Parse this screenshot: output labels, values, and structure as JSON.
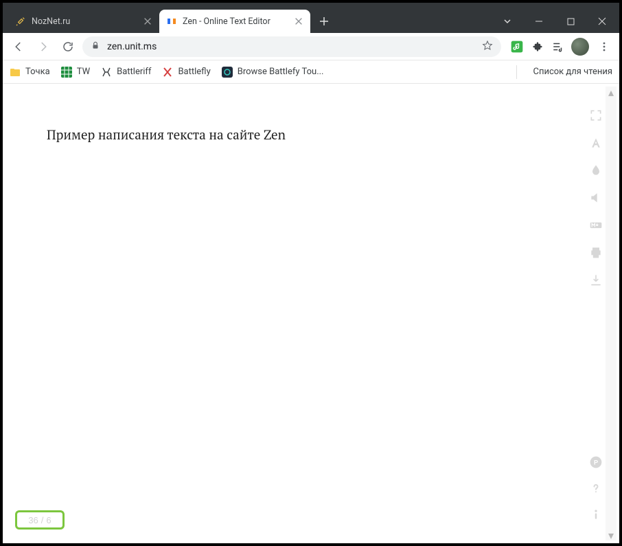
{
  "window": {
    "tabs": [
      {
        "title": "NozNet.ru",
        "active": false
      },
      {
        "title": "Zen - Online Text Editor",
        "active": true
      }
    ]
  },
  "toolbar": {
    "url": "zen.unit.ms"
  },
  "bookmarks": {
    "items": [
      {
        "label": "Точка"
      },
      {
        "label": "TW"
      },
      {
        "label": "Battleriff"
      },
      {
        "label": "Battlefly"
      },
      {
        "label": "Browse Battlefy Tou..."
      }
    ],
    "reading_list_label": "Список для чтения"
  },
  "editor": {
    "content": "Пример написания текста на сайте Zen",
    "char_count": "36",
    "word_count": "6",
    "count_separator": "/"
  }
}
